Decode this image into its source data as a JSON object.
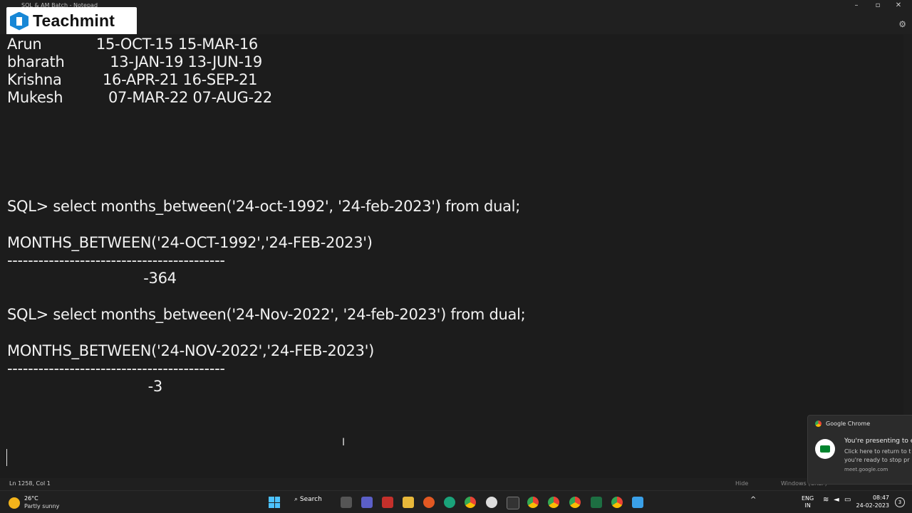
{
  "window": {
    "title": "SQL & AM Batch - Notepad",
    "controls": {
      "minimize": "–",
      "maximize": "▫",
      "close": "✕"
    },
    "settings_icon": "gear-icon"
  },
  "overlay_logo": {
    "text": "Teachmint"
  },
  "editor": {
    "lines": [
      "Arun            15-OCT-15 15-MAR-16",
      "bharath          13-JAN-19 13-JUN-19",
      "Krishna         16-APR-21 16-SEP-21",
      "Mukesh          07-MAR-22 07-AUG-22",
      "SQL> select months_between('24-oct-1992', '24-feb-2023') from dual;",
      "MONTHS_BETWEEN('24-OCT-1992','24-FEB-2023')",
      "------------------------------------------",
      "                              -364",
      "SQL> select months_between('24-Nov-2022', '24-feb-2023') from dual;",
      "MONTHS_BETWEEN('24-NOV-2022','24-FEB-2023')",
      "------------------------------------------",
      "                               -3"
    ]
  },
  "statusbar": {
    "position": "Ln 1258, Col 1",
    "hide_label": "Hide",
    "windows_label": "Windows (CRLF)"
  },
  "notification": {
    "app": "Google Chrome",
    "line1": "You're presenting to ev",
    "line2": "Click here to return to t",
    "line3": "you're ready to stop pr",
    "source": "meet.google.com"
  },
  "taskbar": {
    "weather_temp": "26°C",
    "weather_cond": "Partly sunny",
    "search_label": "Search",
    "lang_top": "ENG",
    "lang_bottom": "IN",
    "time": "08:47",
    "date": "24-02-2023",
    "notifications_count": "3"
  }
}
